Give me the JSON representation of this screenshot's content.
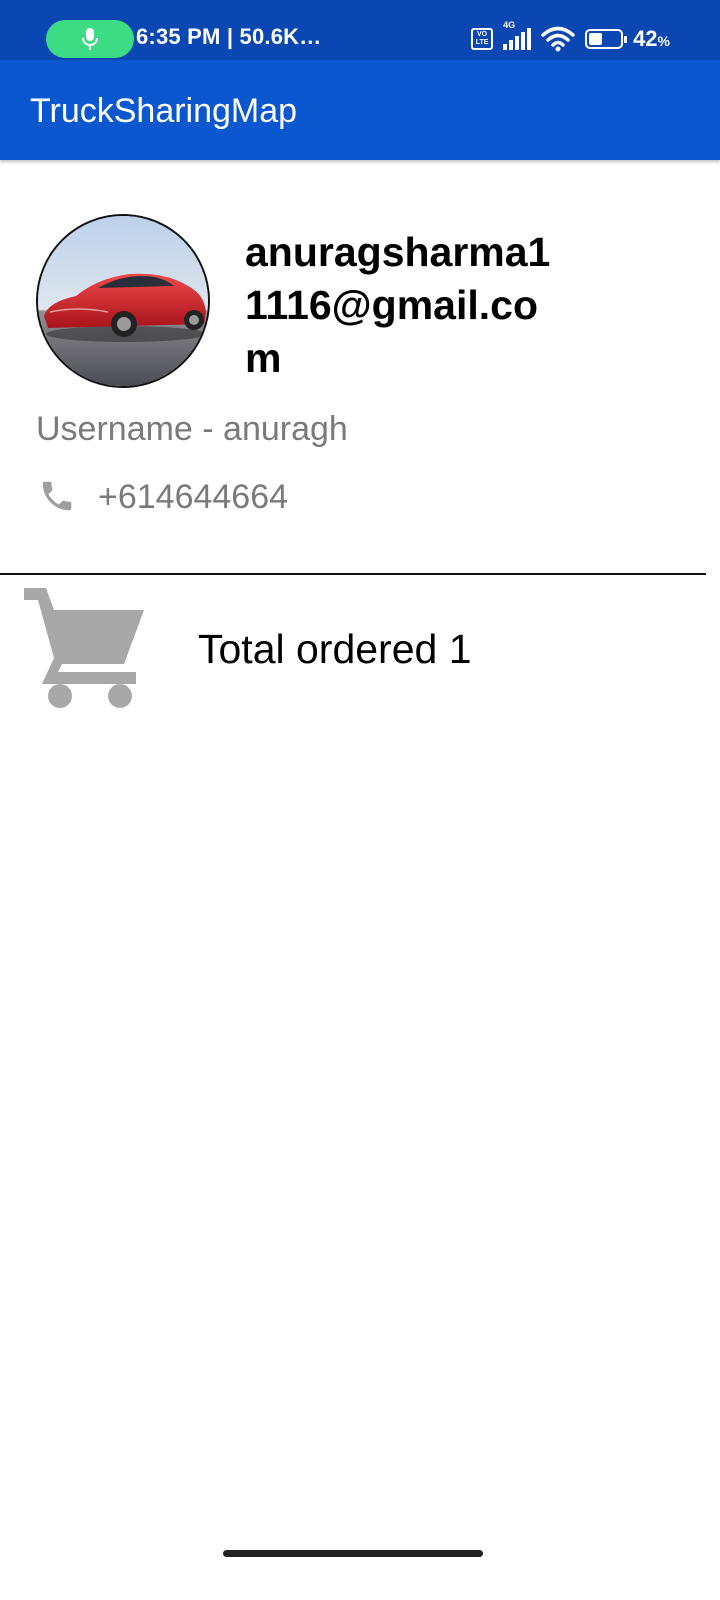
{
  "status_bar": {
    "text": "6:35 PM | 50.6K…",
    "network": "4G",
    "volte": "Vo\nLTE",
    "battery_percent": "42",
    "battery_unit": "%",
    "battery_level": 0.42
  },
  "app_bar": {
    "title": "TruckSharingMap"
  },
  "profile": {
    "email": "anuragsharma11116@gmail.com",
    "username_text": "Username - anuragh",
    "phone": "+614644664"
  },
  "orders": {
    "total_text": "Total ordered 1"
  },
  "colors": {
    "status_bar": "#0a47b3",
    "app_bar": "#0b57d0",
    "mic_pill": "#3ddc84",
    "muted_text": "#7a7a7a",
    "icon_gray": "#a8a8a8"
  },
  "icons": [
    "mic-icon",
    "volte-icon",
    "signal-icon",
    "wifi-icon",
    "battery-icon",
    "phone-icon",
    "cart-icon"
  ]
}
